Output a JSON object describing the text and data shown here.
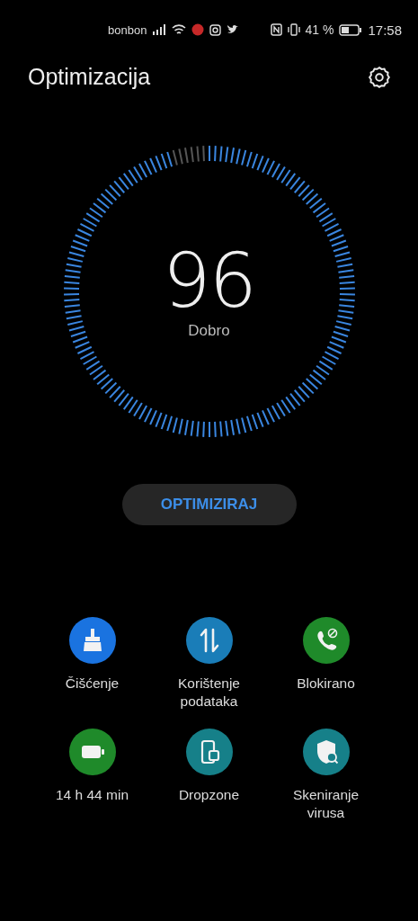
{
  "status_bar": {
    "carrier": "bonbon",
    "battery_percent": "41 %",
    "time": "17:58"
  },
  "header": {
    "title": "Optimizacija"
  },
  "gauge": {
    "score": "96",
    "rating": "Dobro"
  },
  "optimize_button": {
    "label": "OPTIMIZIRAJ"
  },
  "tiles": [
    {
      "label": "Čišćenje",
      "kind": "broom",
      "color": "#1a73e0"
    },
    {
      "label": "Korištenje podataka",
      "kind": "transfer",
      "color": "#1a7db8"
    },
    {
      "label": "Blokirano",
      "kind": "blocked-call",
      "color": "#1f8a2a"
    },
    {
      "label": "14 h 44 min",
      "kind": "battery",
      "color": "#1f8a2a"
    },
    {
      "label": "Dropzone",
      "kind": "devices",
      "color": "#168089"
    },
    {
      "label": "Skeniranje virusa",
      "kind": "shield",
      "color": "#168089"
    }
  ]
}
